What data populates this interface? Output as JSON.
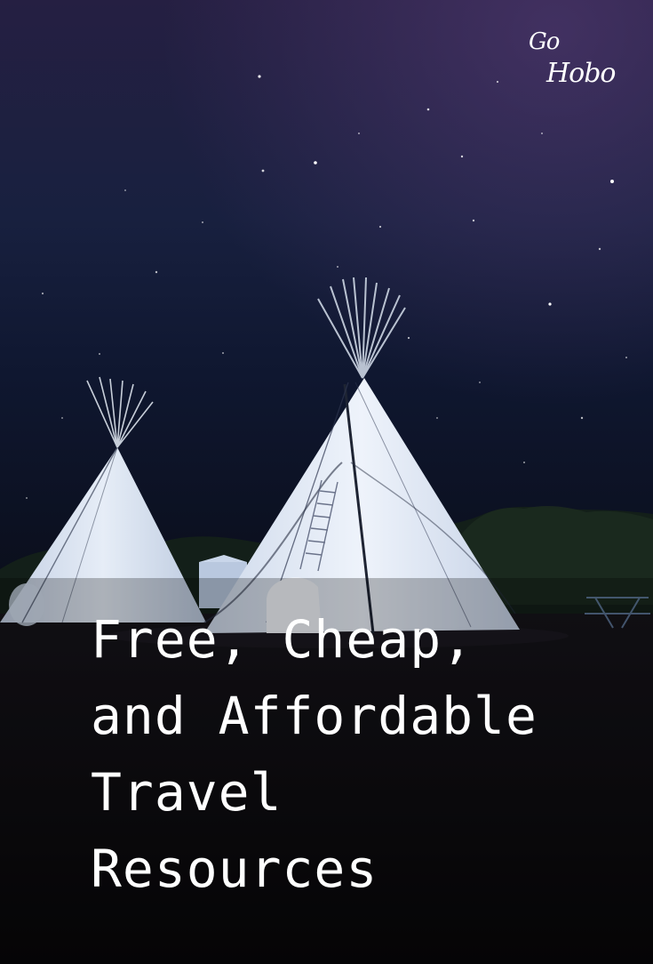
{
  "logo": {
    "line1": "Go",
    "line2": "Hobo"
  },
  "headline": {
    "lines": [
      "Free, Cheap,",
      "and Affordable",
      "Travel",
      "Resources"
    ]
  },
  "colors": {
    "sky_top": "#2a2348",
    "sky_mid": "#141c3a",
    "ground": "#0d0c0e",
    "tent": "#e4ecf6",
    "text": "#ffffff"
  },
  "icons": [
    "gohobo-logo",
    "tipi-tent"
  ]
}
